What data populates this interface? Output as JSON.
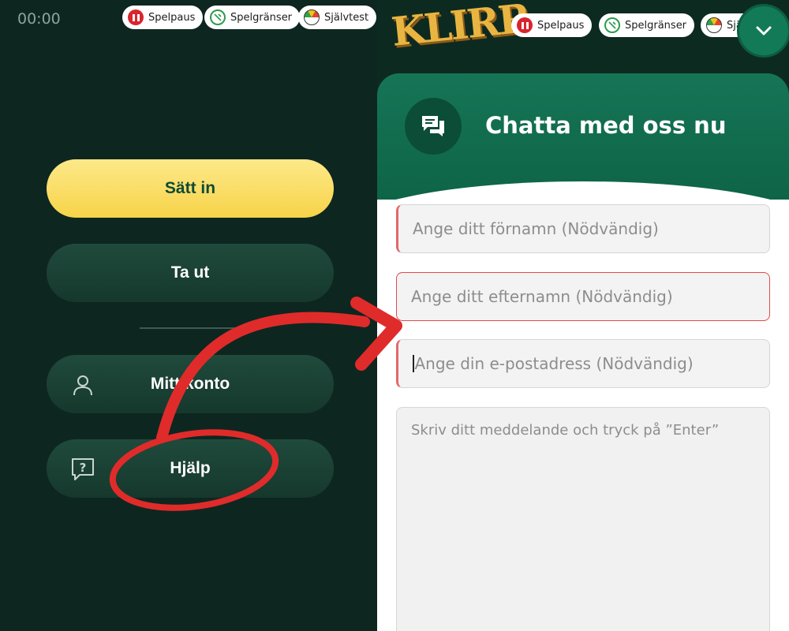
{
  "status": {
    "clock": "00:00"
  },
  "responsible_gaming": {
    "pause_label": "Spelpaus",
    "limits_label": "Spelgränser",
    "selftest_label": "Självtest",
    "selftest_label_clipped": "Självt"
  },
  "menu": {
    "deposit_label": "Sätt in",
    "withdraw_label": "Ta ut",
    "account_label": "Mitt konto",
    "help_label": "Hjälp"
  },
  "brand": {
    "logo_text": "KLIRR"
  },
  "chat": {
    "title": "Chatta med oss nu",
    "first_name_placeholder": "Ange ditt förnamn (Nödvändig)",
    "last_name_placeholder": "Ange ditt efternamn (Nödvändig)",
    "email_placeholder": "Ange din e-postadress (Nödvändig)",
    "message_placeholder": "Skriv ditt meddelande och tryck på ”Enter”"
  },
  "colors": {
    "brand_green": "#137a57",
    "deposit_yellow": "#f7d348",
    "annotation_red": "#e02b2b",
    "error_red": "#e44a4d"
  },
  "icons": [
    "pause-icon",
    "limits-icon",
    "gauge-icon",
    "user-icon",
    "help-icon",
    "chat-icon",
    "chevron-down-icon"
  ]
}
